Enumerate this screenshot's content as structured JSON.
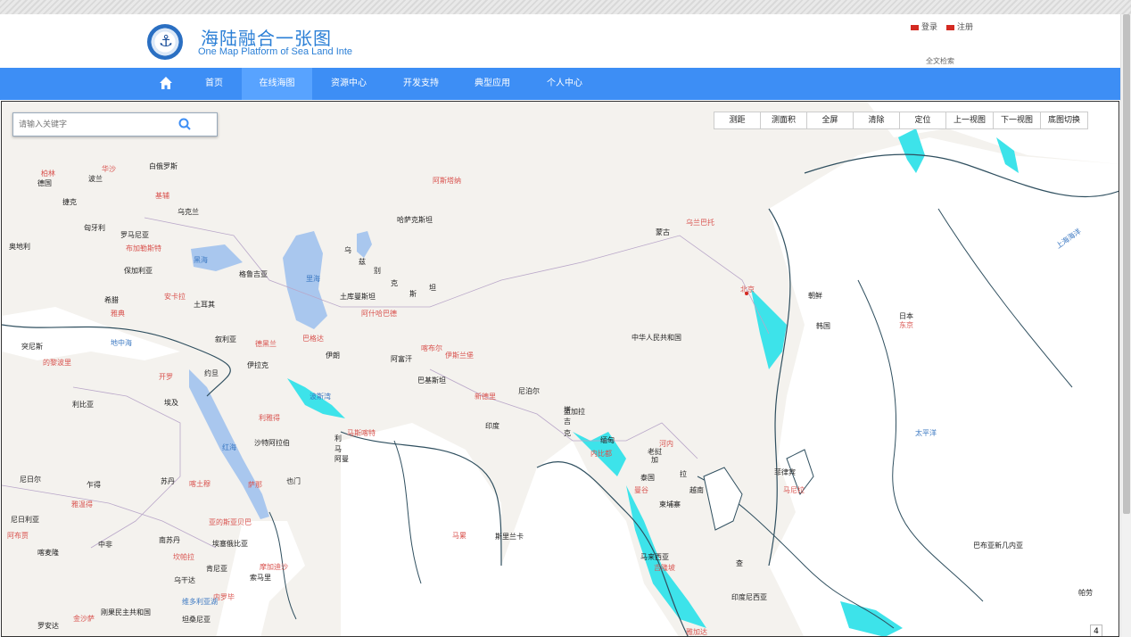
{
  "header": {
    "title": "海陆融合一张图",
    "subtitle": "One Map Platform of Sea Land Inte",
    "login": "登录",
    "register": "注册",
    "fulltext": "全文检索"
  },
  "nav": {
    "items": [
      {
        "label": "首页"
      },
      {
        "label": "在线海图"
      },
      {
        "label": "资源中心"
      },
      {
        "label": "开发支持"
      },
      {
        "label": "典型应用"
      },
      {
        "label": "个人中心"
      }
    ]
  },
  "search": {
    "placeholder": "请输入关键字"
  },
  "toolbar": {
    "buttons": [
      "测距",
      "测面积",
      "全屏",
      "清除",
      "定位",
      "上一视图",
      "下一视图",
      "底图切换"
    ]
  },
  "map": {
    "page_number": "4",
    "labels": {
      "l1": "华沙",
      "l2": "白俄罗斯",
      "l3": "德国",
      "l4": "波兰",
      "l5": "捷克",
      "l6": "基辅",
      "l7": "乌克兰",
      "l8": "匈牙利",
      "l9": "罗马尼亚",
      "l10": "布加勒斯特",
      "l11": "保加利亚",
      "l12": "黑海",
      "l13": "格鲁吉亚",
      "l14": "安卡拉",
      "l15": "土耳其",
      "l16": "希腊",
      "l17": "雅典",
      "l18": "地中海",
      "l19": "突尼斯",
      "l20": "的黎波里",
      "l21": "叙利亚",
      "l22": "巴格达",
      "l23": "伊拉克",
      "l24": "约旦",
      "l25": "开罗",
      "l26": "埃及",
      "l27": "利比亚",
      "l28": "德黑兰",
      "l29": "伊朗",
      "l30": "阿富汗",
      "l31": "巴基斯坦",
      "l32": "里海",
      "l33": "土库曼斯坦",
      "l34": "阿什哈巴德",
      "l35": "哈萨克斯坦",
      "l36": "蒙古",
      "l37": "乌兰巴托",
      "l38": "阿斯塔纳",
      "l39": "北京",
      "l40": "中华人民共和国",
      "l41": "朝鲜",
      "l42": "韩国",
      "l43": "日本",
      "l44": "东京",
      "l45": "喀布尔",
      "l46": "伊斯兰堡",
      "l47": "新德里",
      "l48": "尼泊尔",
      "l49": "印度",
      "l50": "孟加拉",
      "l51": "缅甸",
      "l52": "内比都",
      "l53": "老挝",
      "l54": "河内",
      "l55": "泰国",
      "l56": "曼谷",
      "l57": "越南",
      "l58": "柬埔寨",
      "l59": "菲律宾",
      "l60": "马尼拉",
      "l61": "马来西亚",
      "l62": "吉隆坡",
      "l63": "印度尼西亚",
      "l64": "雅加达",
      "l65": "斯里兰卡",
      "l66": "马累",
      "l67": "波斯湾",
      "l68": "利雅得",
      "l69": "沙特阿拉伯",
      "l70": "红海",
      "l71": "也门",
      "l72": "萨那",
      "l73": "马斯喀特",
      "l74": "阿曼",
      "l75": "苏丹",
      "l76": "喀土穆",
      "l77": "埃塞俄比亚",
      "l78": "亚的斯亚贝巴",
      "l79": "乍得",
      "l80": "尼日尔",
      "l81": "尼日利亚",
      "l82": "阿布贾",
      "l83": "喀麦隆",
      "l84": "中非",
      "l85": "南苏丹",
      "l86": "肯尼亚",
      "l87": "内罗毕",
      "l88": "索马里",
      "l89": "摩加迪沙",
      "l90": "乌干达",
      "l91": "坎帕拉",
      "l92": "刚果民主共和国",
      "l93": "坦桑尼亚",
      "l94": "太平洋",
      "l95": "巴布亚新几内亚",
      "l96": "帕劳",
      "l97": "上海海洋",
      "l98": "金沙萨",
      "l99": "维多利亚湖",
      "l100": "雅温得",
      "l101": "罗安达",
      "l102": "奥地利",
      "l103": "柏林",
      "l104": "乌",
      "l105": "兹",
      "l106": "别",
      "l107": "克",
      "l108": "斯",
      "l109": "坦",
      "l110": "塔",
      "l111": "吉",
      "l112": "克",
      "l113": "利",
      "l114": "马",
      "l115": "加",
      "l116": "拉",
      "l117": "查"
    }
  }
}
